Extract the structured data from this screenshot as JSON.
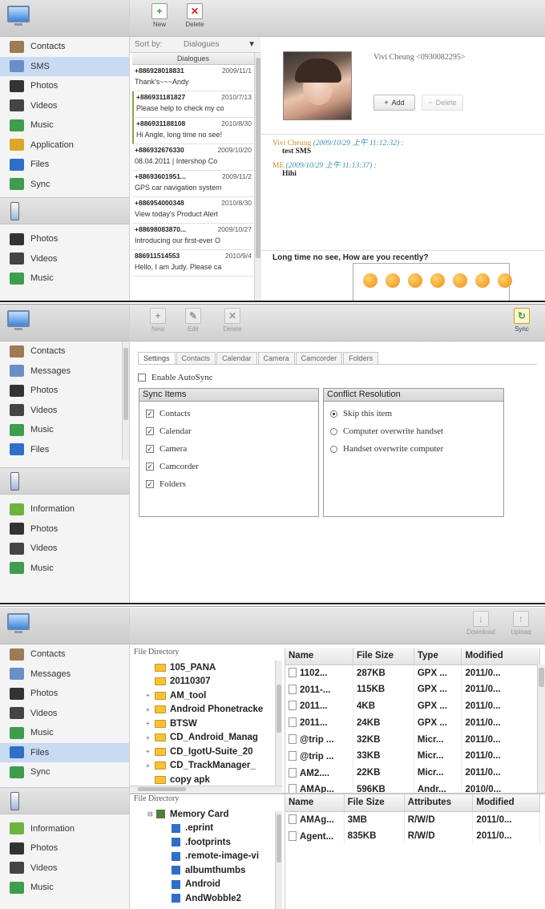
{
  "p1": {
    "sidebar": {
      "items": [
        {
          "label": "Contacts",
          "icon": "contacts-icon",
          "color": "#9c7b55"
        },
        {
          "label": "SMS",
          "icon": "sms-icon",
          "color": "#6a8fc8",
          "selected": true
        },
        {
          "label": "Photos",
          "icon": "camera-icon",
          "color": "#333333"
        },
        {
          "label": "Videos",
          "icon": "video-camera-icon",
          "color": "#444444"
        },
        {
          "label": "Music",
          "icon": "music-icon",
          "color": "#3e9e4e"
        },
        {
          "label": "Application",
          "icon": "application-icon",
          "color": "#d9a72c"
        },
        {
          "label": "Files",
          "icon": "files-icon",
          "color": "#2f6fc7"
        },
        {
          "label": "Sync",
          "icon": "sync-icon",
          "color": "#3e9e4e"
        }
      ],
      "phone_items": [
        {
          "label": "Photos",
          "icon": "camera-icon",
          "color": "#333333"
        },
        {
          "label": "Videos",
          "icon": "video-camera-icon",
          "color": "#444444"
        },
        {
          "label": "Music",
          "icon": "music-icon",
          "color": "#3e9e4e"
        }
      ]
    },
    "toolbar": {
      "new": "New",
      "delete": "Delete"
    },
    "sort": {
      "label": "Sort by:",
      "value": "Dialogues"
    },
    "list_title": "Dialogues",
    "dialogues": [
      {
        "num": "+886928018831",
        "date": "2009/11/1",
        "text": "Thank's~~~Andy",
        "mark": false
      },
      {
        "num": "+886931181827",
        "date": "2010/7/13",
        "text": "Please help to check my co",
        "mark": true
      },
      {
        "num": "+886931188108",
        "date": "2010/8/30",
        "text": "Hi Angle, long time no see!",
        "mark": true
      },
      {
        "num": "+886932676330",
        "date": "2009/10/20",
        "text": "08.04.2011 | Intershop Co",
        "mark": false
      },
      {
        "num": "+88693601951...",
        "date": "2009/11/2",
        "text": "GPS car navigation system",
        "mark": false
      },
      {
        "num": "+886954000348",
        "date": "2010/8/30",
        "text": "View today's Product Alert",
        "mark": false
      },
      {
        "num": "+88698083870...",
        "date": "2009/10/27",
        "text": "Introducing our first-ever O",
        "mark": false
      },
      {
        "num": "886911514553",
        "date": "2010/9/4",
        "text": "Hello, I am Judy. Please ca",
        "mark": false
      }
    ],
    "contact": {
      "name": "Vivi Cheung <0930082295>",
      "add": "Add",
      "delete": "Delete"
    },
    "conversation": [
      {
        "from": "Vivi Cheung",
        "time": "(2009/10/29 上午 11:12:32) :",
        "text": "test SMS"
      },
      {
        "from": "ME",
        "time": "(2009/10/29 上午 11:13:37) :",
        "text": "Hihi"
      }
    ],
    "compose_text": "Long time no see, How are you recently?"
  },
  "p2": {
    "sidebar": {
      "items": [
        {
          "label": "Contacts",
          "icon": "contacts-icon",
          "color": "#9c7b55"
        },
        {
          "label": "Messages",
          "icon": "messages-icon",
          "color": "#6a8fc8"
        },
        {
          "label": "Photos",
          "icon": "camera-icon",
          "color": "#333333"
        },
        {
          "label": "Videos",
          "icon": "video-camera-icon",
          "color": "#444444"
        },
        {
          "label": "Music",
          "icon": "music-icon",
          "color": "#3e9e4e"
        },
        {
          "label": "Files",
          "icon": "files-icon",
          "color": "#2f6fc7"
        }
      ],
      "phone_items": [
        {
          "label": "Information",
          "icon": "information-icon",
          "color": "#6cb33f"
        },
        {
          "label": "Photos",
          "icon": "camera-icon",
          "color": "#333333"
        },
        {
          "label": "Videos",
          "icon": "video-camera-icon",
          "color": "#444444"
        },
        {
          "label": "Music",
          "icon": "music-icon",
          "color": "#3e9e4e"
        }
      ]
    },
    "toolbar": {
      "new": "New",
      "edit": "Edit",
      "delete": "Delete",
      "sync": "Sync"
    },
    "tabs": [
      "Settings",
      "Contacts",
      "Calendar",
      "Camera",
      "Camcorder",
      "Folders"
    ],
    "enable_autosync": "Enable AutoSync",
    "sync_items": {
      "title": "Sync Items",
      "items": [
        "Contacts",
        "Calendar",
        "Camera",
        "Camcorder",
        "Folders"
      ]
    },
    "conflict": {
      "title": "Conflict Resolution",
      "options": [
        "Skip this item",
        "Computer overwrite handset",
        "Handset overwrite computer"
      ]
    }
  },
  "p3": {
    "sidebar": {
      "items": [
        {
          "label": "Contacts",
          "icon": "contacts-icon",
          "color": "#9c7b55"
        },
        {
          "label": "Messages",
          "icon": "messages-icon",
          "color": "#6a8fc8"
        },
        {
          "label": "Photos",
          "icon": "camera-icon",
          "color": "#333333"
        },
        {
          "label": "Videos",
          "icon": "video-camera-icon",
          "color": "#444444"
        },
        {
          "label": "Music",
          "icon": "music-icon",
          "color": "#3e9e4e"
        },
        {
          "label": "Files",
          "icon": "files-icon",
          "color": "#2f6fc7",
          "selected": true
        },
        {
          "label": "Sync",
          "icon": "sync-icon",
          "color": "#3e9e4e"
        }
      ],
      "phone_items": [
        {
          "label": "Information",
          "icon": "information-icon",
          "color": "#6cb33f"
        },
        {
          "label": "Photos",
          "icon": "camera-icon",
          "color": "#333333"
        },
        {
          "label": "Videos",
          "icon": "video-camera-icon",
          "color": "#444444"
        },
        {
          "label": "Music",
          "icon": "music-icon",
          "color": "#3e9e4e"
        }
      ]
    },
    "toolbar": {
      "download": "Download",
      "upload": "Upload"
    },
    "dir_title": "File Directory",
    "pc_folders": [
      {
        "name": "105_PANA",
        "exp": ""
      },
      {
        "name": "20110307",
        "exp": ""
      },
      {
        "name": "AM_tool",
        "exp": "+"
      },
      {
        "name": "Android Phonetracke",
        "exp": "+"
      },
      {
        "name": "BTSW",
        "exp": "+"
      },
      {
        "name": "CD_Android_Manag",
        "exp": "+"
      },
      {
        "name": "CD_IgotU-Suite_20",
        "exp": "+"
      },
      {
        "name": "CD_TrackManager_",
        "exp": "+"
      },
      {
        "name": "copy apk",
        "exp": ""
      }
    ],
    "pc_headers": [
      "Name",
      "File Size",
      "Type",
      "Modified"
    ],
    "pc_files": [
      [
        "1102...",
        "287KB",
        "GPX ...",
        "2011/0..."
      ],
      [
        "2011-...",
        "115KB",
        "GPX ...",
        "2011/0..."
      ],
      [
        "2011...",
        "4KB",
        "GPX ...",
        "2011/0..."
      ],
      [
        "2011...",
        "24KB",
        "GPX ...",
        "2011/0..."
      ],
      [
        "@trip ...",
        "32KB",
        "Micr...",
        "2011/0..."
      ],
      [
        "@trip ...",
        "33KB",
        "Micr...",
        "2011/0..."
      ],
      [
        "AM2....",
        "22KB",
        "Micr...",
        "2011/0..."
      ],
      [
        "AMAp...",
        "596KB",
        "Andr...",
        "2010/0..."
      ]
    ],
    "device_root": "Memory Card",
    "device_folders": [
      ".eprint",
      ".footprints",
      ".remote-image-vi",
      "albumthumbs",
      "Android",
      "AndWobble2"
    ],
    "dev_headers": [
      "Name",
      "File Size",
      "Attributes",
      "Modified"
    ],
    "dev_files": [
      [
        "AMAg...",
        "3MB",
        "R/W/D",
        "2011/0..."
      ],
      [
        "Agent...",
        "835KB",
        "R/W/D",
        "2011/0..."
      ]
    ]
  }
}
